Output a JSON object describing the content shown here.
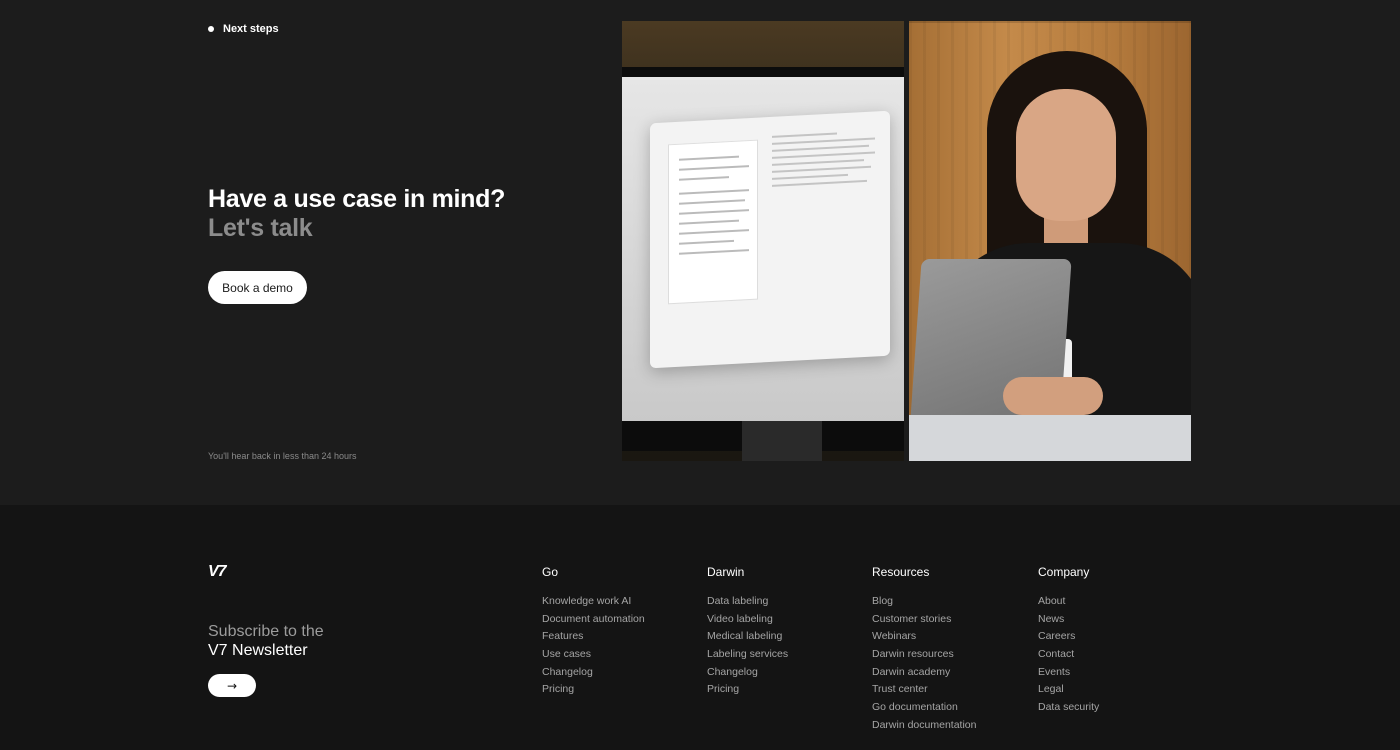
{
  "cta": {
    "eyebrow": "Next steps",
    "headline_line1": "Have a use case in mind?",
    "headline_line2": "Let's talk",
    "book_label": "Book a demo",
    "note": "You'll hear back in less than 24 hours"
  },
  "footer": {
    "logo": "V7",
    "newsletter_line1": "Subscribe to the",
    "newsletter_line2": "V7 Newsletter",
    "subscribe_icon": "arrow-right-icon",
    "columns": [
      {
        "title": "Go",
        "links": [
          "Knowledge work AI",
          "Document automation",
          "Features",
          "Use cases",
          "Changelog",
          "Pricing"
        ]
      },
      {
        "title": "Darwin",
        "links": [
          "Data labeling",
          "Video labeling",
          "Medical labeling",
          "Labeling services",
          "Changelog",
          "Pricing"
        ]
      },
      {
        "title": "Resources",
        "links": [
          "Blog",
          "Customer stories",
          "Webinars",
          "Darwin resources",
          "Darwin academy",
          "Trust center",
          "Go documentation",
          "Darwin documentation"
        ]
      },
      {
        "title": "Company",
        "links": [
          "About",
          "News",
          "Careers",
          "Contact",
          "Events",
          "Legal",
          "Data security"
        ]
      }
    ]
  },
  "colors": {
    "page_bg": "#1c1c1c",
    "footer_bg": "#141414",
    "muted_text": "#8c8c8c",
    "button_bg": "#ffffff"
  }
}
